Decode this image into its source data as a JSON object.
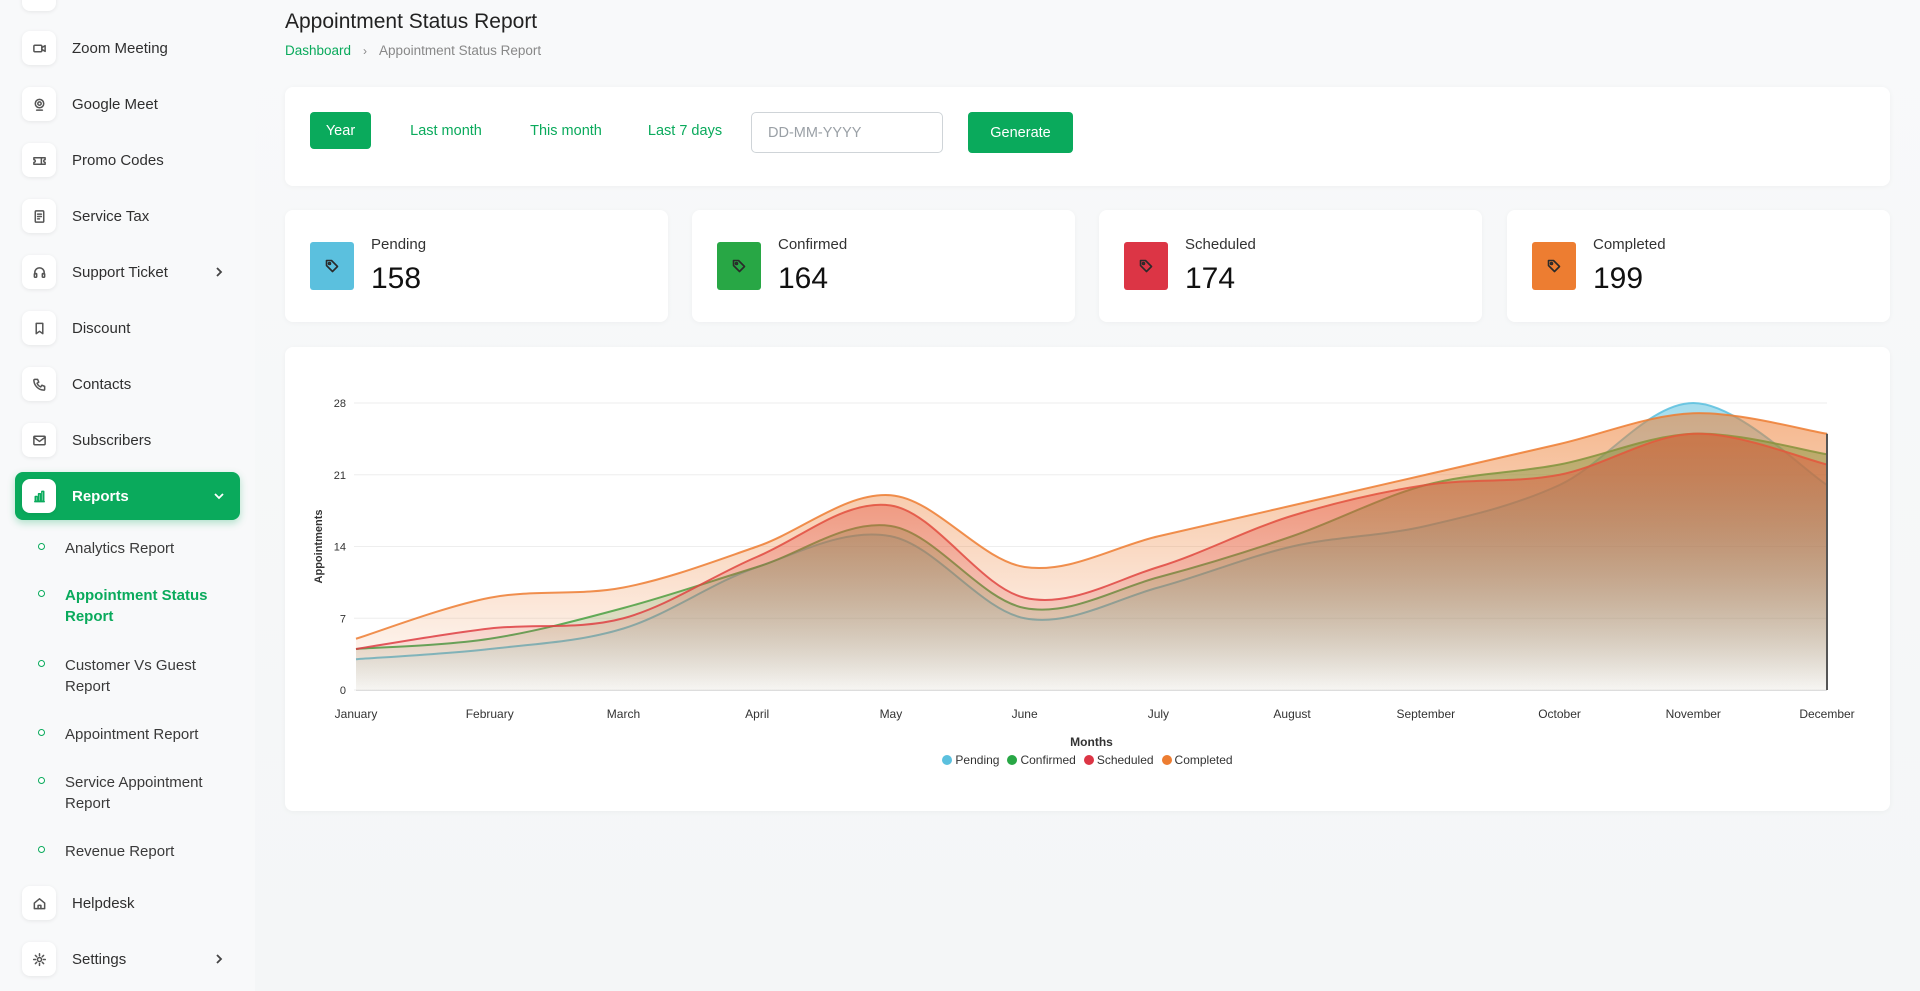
{
  "sidebar": {
    "items": [
      {
        "id": "zoom",
        "label": "Zoom Meeting",
        "icon": "video-icon"
      },
      {
        "id": "meet",
        "label": "Google Meet",
        "icon": "webcam-icon"
      },
      {
        "id": "promo",
        "label": "Promo Codes",
        "icon": "ticket-icon"
      },
      {
        "id": "tax",
        "label": "Service Tax",
        "icon": "receipt-icon"
      },
      {
        "id": "support",
        "label": "Support Ticket",
        "icon": "headset-icon"
      },
      {
        "id": "discount",
        "label": "Discount",
        "icon": "bookmark-icon"
      },
      {
        "id": "contacts",
        "label": "Contacts",
        "icon": "phone-icon"
      },
      {
        "id": "subscribers",
        "label": "Subscribers",
        "icon": "mail-icon"
      },
      {
        "id": "reports",
        "label": "Reports",
        "icon": "bar-chart-icon"
      }
    ],
    "report_subitems": [
      "Analytics Report",
      "Appointment Status Report",
      "Customer Vs Guest Report",
      "Appointment Report",
      "Service Appointment Report",
      "Revenue Report"
    ],
    "bottom_items": [
      {
        "id": "helpdesk",
        "label": "Helpdesk",
        "icon": "home-icon"
      },
      {
        "id": "settings",
        "label": "Settings",
        "icon": "gear-icon"
      }
    ]
  },
  "header": {
    "title": "Appointment Status Report",
    "breadcrumb_home": "Dashboard",
    "breadcrumb_current": "Appointment Status Report"
  },
  "filters": {
    "year": "Year",
    "last_month": "Last month",
    "this_month": "This month",
    "last_7_days": "Last 7 days",
    "date_placeholder": "DD-MM-YYYY",
    "generate": "Generate",
    "active": "Year"
  },
  "stats": [
    {
      "label": "Pending",
      "value": "158",
      "color": "#5bc0de"
    },
    {
      "label": "Confirmed",
      "value": "164",
      "color": "#28a745"
    },
    {
      "label": "Scheduled",
      "value": "174",
      "color": "#dc3545"
    },
    {
      "label": "Completed",
      "value": "199",
      "color": "#ed7d31"
    }
  ],
  "chart_data": {
    "type": "area",
    "categories": [
      "January",
      "February",
      "March",
      "April",
      "May",
      "June",
      "July",
      "August",
      "September",
      "October",
      "November",
      "December"
    ],
    "xlabel": "Months",
    "ylabel": "Appointments",
    "ylim": [
      0,
      28
    ],
    "yticks": [
      0,
      7,
      14,
      21,
      28
    ],
    "legend_position": "bottom",
    "series": [
      {
        "name": "Pending",
        "color": "#5bc0de",
        "values": [
          3,
          4,
          6,
          12,
          15,
          7,
          10,
          14,
          16,
          20,
          28,
          20
        ]
      },
      {
        "name": "Confirmed",
        "color": "#28a745",
        "values": [
          4,
          5,
          8,
          12,
          16,
          8,
          11,
          15,
          20,
          22,
          25,
          23
        ]
      },
      {
        "name": "Scheduled",
        "color": "#dc3545",
        "values": [
          4,
          6,
          7,
          13,
          18,
          9,
          12,
          17,
          20,
          21,
          25,
          22
        ]
      },
      {
        "name": "Completed",
        "color": "#ed7d31",
        "values": [
          5,
          9,
          10,
          14,
          19,
          12,
          15,
          18,
          21,
          24,
          27,
          25
        ]
      }
    ]
  }
}
